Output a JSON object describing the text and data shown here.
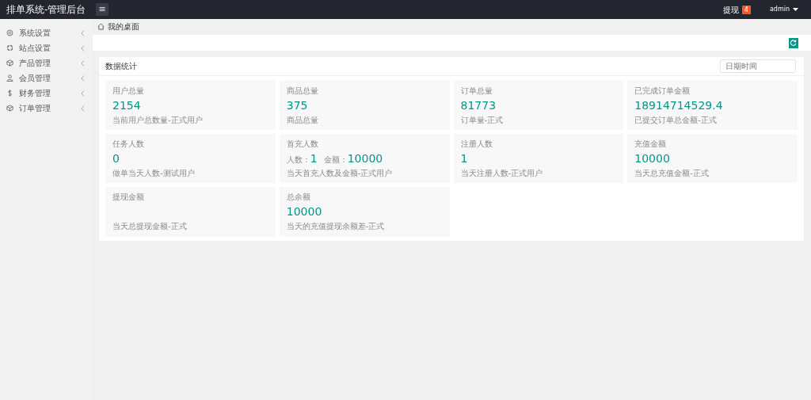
{
  "header": {
    "title": "排单系统-管理后台",
    "menu_toggle": "≡",
    "withdraw_link": "提现",
    "withdraw_badge": "4",
    "user": "admin"
  },
  "sidebar": {
    "items": [
      {
        "label": "系统设置",
        "expanded": false
      },
      {
        "label": "站点设置",
        "expanded": false
      },
      {
        "label": "产品管理",
        "expanded": false
      },
      {
        "label": "会员管理",
        "expanded": false
      },
      {
        "label": "财务管理",
        "expanded": false
      },
      {
        "label": "订单管理",
        "expanded": false
      }
    ]
  },
  "breadcrumb": {
    "label": "我的桌面"
  },
  "stats_panel": {
    "title": "数据统计",
    "date_field": {
      "placeholder": "日期时间"
    },
    "tiles": [
      {
        "kind": "single",
        "label": "用户总量",
        "value": "2154",
        "note": "当前用户总数量-正式用户"
      },
      {
        "kind": "single",
        "label": "商品总量",
        "value": "375",
        "note": "商品总量"
      },
      {
        "kind": "single",
        "label": "订单总量",
        "value": "81773",
        "note": "订单量-正式"
      },
      {
        "kind": "single",
        "label": "已完成订单金额",
        "value": "18914714529.4",
        "note": "已提交订单总金额-正式"
      },
      {
        "kind": "single",
        "label": "任务人数",
        "value": "0",
        "note": "做单当天人数-测试用户"
      },
      {
        "kind": "pair",
        "label": "首充人数",
        "prefix_1": "人数：",
        "value": "1",
        "prefix_2": "金额：",
        "value_2": "10000",
        "note": "当天首充人数及金额-正式用户"
      },
      {
        "kind": "single",
        "label": "注册人数",
        "value": "1",
        "note": "当天注册人数-正式用户"
      },
      {
        "kind": "single",
        "label": "充值金额",
        "value": "10000",
        "note": "当天总充值金额-正式"
      },
      {
        "kind": "single",
        "label": "提现金额",
        "note": "当天总提现金额-正式"
      },
      {
        "kind": "single",
        "label": "总余额",
        "value": "10000",
        "note": "当天的充值提现余额差-正式"
      }
    ]
  }
}
